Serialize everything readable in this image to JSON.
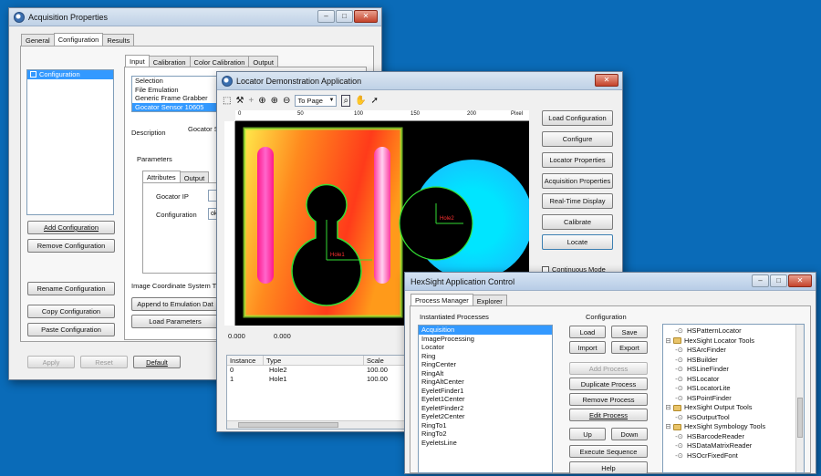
{
  "acq": {
    "title": "Acquisition Properties",
    "tabs": [
      "General",
      "Configuration",
      "Results"
    ],
    "config_item": "Configuration",
    "inner_tabs": [
      "Input",
      "Calibration",
      "Color Calibration",
      "Output"
    ],
    "input_list": [
      "Selection",
      "File Emulation",
      "Generic Frame Grabber",
      "Gocator Sensor 10605"
    ],
    "description_label": "Description",
    "description_value": "Gocator S",
    "parameters_label": "Parameters",
    "param_tabs": [
      "Attributes",
      "Output"
    ],
    "gocator_ip_label": "Gocator IP",
    "configuration_label": "Configuration",
    "image_coord_label": "Image Coordinate System T",
    "buttons": {
      "add": "Add Configuration",
      "remove": "Remove Configuration",
      "rename": "Rename Configuration",
      "copy": "Copy Configuration",
      "paste": "Paste Configuration",
      "append": "Append to Emulation Dat",
      "load_params": "Load Parameters",
      "apply": "Apply",
      "reset": "Reset",
      "default": "Default"
    }
  },
  "loc": {
    "title": "Locator Demonstration Application",
    "zoom_select": "To Page",
    "ruler_unit": "Pixel",
    "ruler_ticks": [
      "0",
      "50",
      "100",
      "150",
      "200"
    ],
    "coord_x": "0.000",
    "coord_y": "0.000",
    "overlay_labels": [
      "Hole2",
      "Hole1"
    ],
    "table_headers": [
      "Instance",
      "Type",
      "Scale"
    ],
    "table_rows": [
      {
        "instance": "0",
        "type": "Hole2",
        "scale": "100.00"
      },
      {
        "instance": "1",
        "type": "Hole1",
        "scale": "100.00"
      }
    ],
    "buttons": {
      "load_config": "Load Configuration",
      "configure": "Configure",
      "locator_props": "Locator Properties",
      "acq_props": "Acquisition Properties",
      "realtime": "Real-Time Display",
      "calibrate": "Calibrate",
      "locate": "Locate"
    },
    "continuous_mode": "Continuous Mode"
  },
  "hex": {
    "title": "HexSight Application Control",
    "tabs": [
      "Process Manager",
      "Explorer"
    ],
    "instantiated_label": "Instantiated Processes",
    "processes": [
      "Acquisition",
      "ImageProcessing",
      "Locator",
      "Ring",
      "RingCenter",
      "RingAlt",
      "RingAltCenter",
      "EyeletFinder1",
      "Eyelet1Center",
      "EyeletFinder2",
      "Eyelet2Center",
      "RingTo1",
      "RingTo2",
      "EyeletsLine"
    ],
    "configuration_label": "Configuration",
    "buttons": {
      "load": "Load",
      "save": "Save",
      "import": "Import",
      "export": "Export",
      "add_process": "Add Process",
      "duplicate": "Duplicate Process",
      "remove": "Remove Process",
      "edit": "Edit Process",
      "up": "Up",
      "down": "Down",
      "execute": "Execute Sequence",
      "help": "Help"
    },
    "tree": [
      {
        "kind": "leaf",
        "label": "HSPatternLocator"
      },
      {
        "kind": "folder",
        "label": "HexSight Locator Tools"
      },
      {
        "kind": "leaf",
        "label": "HSArcFinder"
      },
      {
        "kind": "leaf",
        "label": "HSBuilder"
      },
      {
        "kind": "leaf",
        "label": "HSLineFinder"
      },
      {
        "kind": "leaf",
        "label": "HSLocator"
      },
      {
        "kind": "leaf",
        "label": "HSLocatorLite"
      },
      {
        "kind": "leaf",
        "label": "HSPointFinder"
      },
      {
        "kind": "folder",
        "label": "HexSight Output Tools"
      },
      {
        "kind": "leaf",
        "label": "HSOutputTool"
      },
      {
        "kind": "folder",
        "label": "HexSight Symbology Tools"
      },
      {
        "kind": "leaf",
        "label": "HSBarcodeReader"
      },
      {
        "kind": "leaf",
        "label": "HSDataMatrixReader"
      },
      {
        "kind": "leaf",
        "label": "HSOcrFixedFont"
      }
    ]
  }
}
